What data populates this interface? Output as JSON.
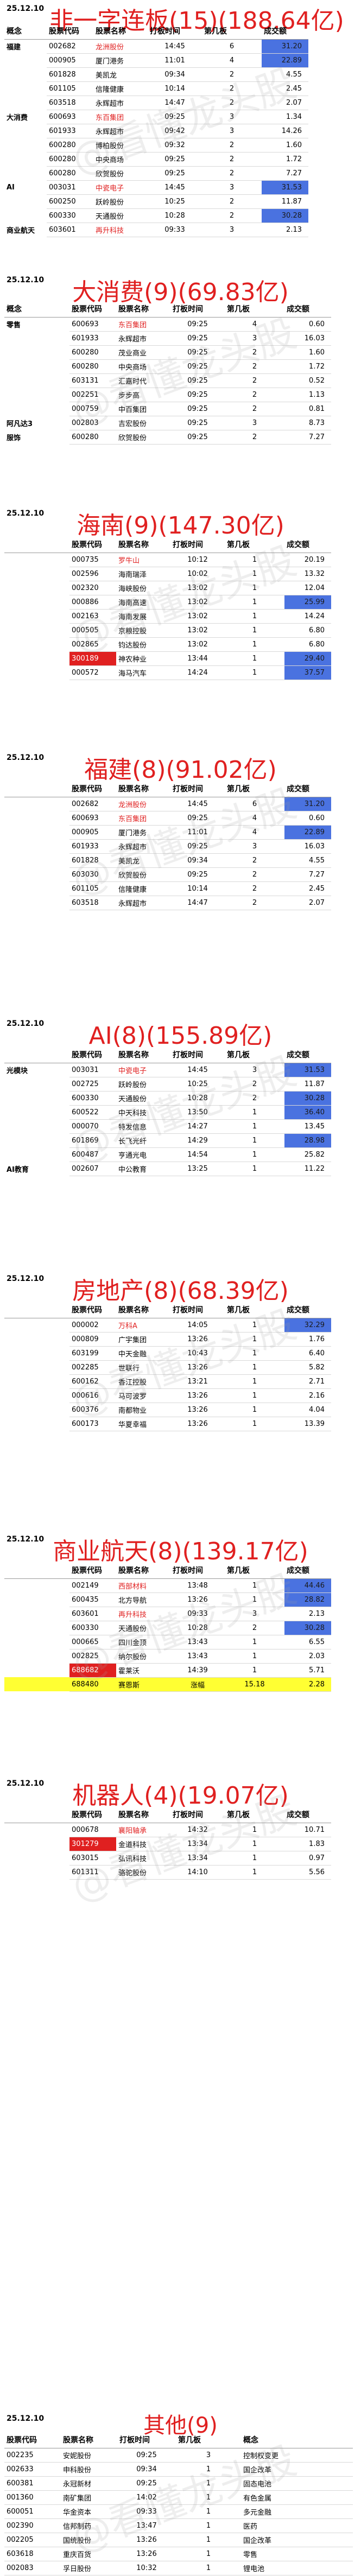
{
  "watermark": "@看懂龙头股",
  "colors": {
    "title_red": "#e02020",
    "amount_highlight": "#4a72e0",
    "row_highlight": "#ffff33"
  },
  "sections": [
    {
      "date": "25.12.10",
      "title": "非一字连板(15)(188.64亿)",
      "headers": [
        "概念",
        "股票代码",
        "股票名称",
        "打板时间",
        "第几板",
        "成交额"
      ],
      "rows": [
        {
          "concept": "福建",
          "code": "002682",
          "name": "龙洲股份",
          "time": "14:45",
          "board": "6",
          "amount": "31.20"
        },
        {
          "concept": "",
          "code": "000905",
          "name": "厦门港务",
          "time": "11:01",
          "board": "4",
          "amount": "22.89"
        },
        {
          "concept": "",
          "code": "601828",
          "name": "美凯龙",
          "time": "09:34",
          "board": "2",
          "amount": "4.55"
        },
        {
          "concept": "",
          "code": "601105",
          "name": "信隆健康",
          "time": "10:14",
          "board": "2",
          "amount": "2.45"
        },
        {
          "concept": "",
          "code": "603518",
          "name": "永辉超市",
          "time": "14:47",
          "board": "2",
          "amount": "2.07"
        },
        {
          "concept": "大消费",
          "code": "600693",
          "name": "东百集团",
          "time": "09:25",
          "board": "3",
          "amount": "1.34"
        },
        {
          "concept": "",
          "code": "601933",
          "name": "永辉超市",
          "time": "09:42",
          "board": "3",
          "amount": "14.26"
        },
        {
          "concept": "",
          "code": "600280",
          "name": "博柏股份",
          "time": "09:32",
          "board": "2",
          "amount": "1.60"
        },
        {
          "concept": "",
          "code": "600280",
          "name": "中央商场",
          "time": "09:25",
          "board": "2",
          "amount": "1.72"
        },
        {
          "concept": "",
          "code": "600280",
          "name": "欣贺股份",
          "time": "09:25",
          "board": "2",
          "amount": "7.27"
        },
        {
          "concept": "AI",
          "code": "003031",
          "name": "中瓷电子",
          "time": "14:45",
          "board": "3",
          "amount": "31.53"
        },
        {
          "concept": "",
          "code": "600250",
          "name": "跃岭股份",
          "time": "10:25",
          "board": "2",
          "amount": "11.87"
        },
        {
          "concept": "",
          "code": "600330",
          "name": "天通股份",
          "time": "10:28",
          "board": "2",
          "amount": "30.28"
        },
        {
          "concept": "商业航天",
          "code": "603601",
          "name": "再升科技",
          "time": "09:33",
          "board": "3",
          "amount": "2.13"
        }
      ]
    },
    {
      "date": "25.12.10",
      "title": "大消费(9)(69.83亿)",
      "headers": [
        "概念",
        "股票代码",
        "股票名称",
        "打板时间",
        "第几板",
        "成交额"
      ],
      "rows": [
        {
          "concept": "零售",
          "code": "600693",
          "name": "东百集团",
          "time": "09:25",
          "board": "4",
          "amount": "0.60"
        },
        {
          "concept": "",
          "code": "601933",
          "name": "永辉超市",
          "time": "09:25",
          "board": "3",
          "amount": "16.03"
        },
        {
          "concept": "",
          "code": "600280",
          "name": "茂业商业",
          "time": "09:25",
          "board": "2",
          "amount": "1.60"
        },
        {
          "concept": "",
          "code": "600280",
          "name": "中央商场",
          "time": "09:25",
          "board": "2",
          "amount": "1.72"
        },
        {
          "concept": "",
          "code": "603131",
          "name": "汇嘉时代",
          "time": "09:25",
          "board": "2",
          "amount": "0.52"
        },
        {
          "concept": "",
          "code": "002251",
          "name": "步步高",
          "time": "09:25",
          "board": "2",
          "amount": "1.13"
        },
        {
          "concept": "",
          "code": "000759",
          "name": "中百集团",
          "time": "09:25",
          "board": "2",
          "amount": "0.81"
        },
        {
          "concept": "阿凡达3",
          "code": "002803",
          "name": "吉宏股份",
          "time": "09:25",
          "board": "3",
          "amount": "8.73"
        },
        {
          "concept": "服饰",
          "code": "600280",
          "name": "欣贺股份",
          "time": "09:25",
          "board": "2",
          "amount": "7.27"
        }
      ]
    },
    {
      "date": "25.12.10",
      "title": "海南(9)(147.30亿)",
      "headers": [
        "",
        "股票代码",
        "股票名称",
        "打板时间",
        "第几板",
        "成交额"
      ],
      "rows": [
        {
          "concept": "",
          "code": "000735",
          "name": "罗牛山",
          "time": "10:12",
          "board": "1",
          "amount": "20.19"
        },
        {
          "concept": "",
          "code": "002596",
          "name": "海南瑞泽",
          "time": "10:02",
          "board": "1",
          "amount": "13.32"
        },
        {
          "concept": "",
          "code": "002320",
          "name": "海峡股份",
          "time": "13:02",
          "board": "1",
          "amount": "12.04"
        },
        {
          "concept": "",
          "code": "000886",
          "name": "海南高速",
          "time": "13:02",
          "board": "1",
          "amount": "25.99"
        },
        {
          "concept": "",
          "code": "002163",
          "name": "海南发展",
          "time": "13:02",
          "board": "1",
          "amount": "14.24"
        },
        {
          "concept": "",
          "code": "000505",
          "name": "京粮控股",
          "time": "13:02",
          "board": "1",
          "amount": "6.80"
        },
        {
          "concept": "",
          "code": "002865",
          "name": "钧达股份",
          "time": "13:02",
          "board": "1",
          "amount": "6.80"
        },
        {
          "concept": "",
          "code": "300189",
          "name": "神农种业",
          "time": "13:44",
          "board": "1",
          "amount": "29.40"
        },
        {
          "concept": "",
          "code": "000572",
          "name": "海马汽车",
          "time": "14:24",
          "board": "1",
          "amount": "37.57"
        }
      ]
    },
    {
      "date": "25.12.10",
      "title": "福建(8)(91.02亿)",
      "headers": [
        "",
        "股票代码",
        "股票名称",
        "打板时间",
        "第几板",
        "成交额"
      ],
      "rows": [
        {
          "concept": "",
          "code": "002682",
          "name": "龙洲股份",
          "time": "14:45",
          "board": "6",
          "amount": "31.20"
        },
        {
          "concept": "",
          "code": "600693",
          "name": "东百集团",
          "time": "09:25",
          "board": "4",
          "amount": "0.60"
        },
        {
          "concept": "",
          "code": "000905",
          "name": "厦门港务",
          "time": "11:01",
          "board": "4",
          "amount": "22.89"
        },
        {
          "concept": "",
          "code": "601933",
          "name": "永辉超市",
          "time": "09:25",
          "board": "3",
          "amount": "16.03"
        },
        {
          "concept": "",
          "code": "601828",
          "name": "美凯龙",
          "time": "09:34",
          "board": "2",
          "amount": "4.55"
        },
        {
          "concept": "",
          "code": "603030",
          "name": "欣贺股份",
          "time": "09:25",
          "board": "2",
          "amount": "7.27"
        },
        {
          "concept": "",
          "code": "601105",
          "name": "信隆健康",
          "time": "10:14",
          "board": "2",
          "amount": "2.45"
        },
        {
          "concept": "",
          "code": "603518",
          "name": "永辉超市",
          "time": "14:47",
          "board": "2",
          "amount": "2.07"
        }
      ]
    },
    {
      "date": "25.12.10",
      "title": "AI(8)(155.89亿)",
      "headers": [
        "",
        "股票代码",
        "股票名称",
        "打板时间",
        "第几板",
        "成交额"
      ],
      "rows": [
        {
          "concept": "光模块",
          "code": "003031",
          "name": "中瓷电子",
          "time": "14:45",
          "board": "3",
          "amount": "31.53"
        },
        {
          "concept": "",
          "code": "002725",
          "name": "跃岭股份",
          "time": "10:25",
          "board": "2",
          "amount": "11.87"
        },
        {
          "concept": "",
          "code": "600330",
          "name": "天通股份",
          "time": "10:28",
          "board": "2",
          "amount": "30.28"
        },
        {
          "concept": "",
          "code": "600522",
          "name": "中天科技",
          "time": "13:50",
          "board": "1",
          "amount": "36.40"
        },
        {
          "concept": "",
          "code": "000070",
          "name": "特发信息",
          "time": "14:27",
          "board": "1",
          "amount": "13.45"
        },
        {
          "concept": "",
          "code": "601869",
          "name": "长飞光纤",
          "time": "14:29",
          "board": "1",
          "amount": "28.98"
        },
        {
          "concept": "",
          "code": "600487",
          "name": "亨通光电",
          "time": "14:54",
          "board": "1",
          "amount": "25.82"
        },
        {
          "concept": "AI教育",
          "code": "002607",
          "name": "中公教育",
          "time": "13:25",
          "board": "1",
          "amount": "11.22"
        }
      ]
    },
    {
      "date": "25.12.10",
      "title": "房地产(8)(68.39亿)",
      "headers": [
        "",
        "股票代码",
        "股票名称",
        "打板时间",
        "第几板",
        "成交额"
      ],
      "rows": [
        {
          "concept": "",
          "code": "000002",
          "name": "万科A",
          "time": "14:05",
          "board": "1",
          "amount": "32.29"
        },
        {
          "concept": "",
          "code": "000809",
          "name": "广宇集团",
          "time": "13:26",
          "board": "1",
          "amount": "1.76"
        },
        {
          "concept": "",
          "code": "603199",
          "name": "中天金融",
          "time": "10:43",
          "board": "1",
          "amount": "6.40"
        },
        {
          "concept": "",
          "code": "002285",
          "name": "世联行",
          "time": "13:26",
          "board": "1",
          "amount": "5.82"
        },
        {
          "concept": "",
          "code": "600162",
          "name": "香江控股",
          "time": "13:21",
          "board": "1",
          "amount": "2.71"
        },
        {
          "concept": "",
          "code": "000616",
          "name": "马可波罗",
          "time": "13:26",
          "board": "1",
          "amount": "2.16"
        },
        {
          "concept": "",
          "code": "600376",
          "name": "南都物业",
          "time": "13:26",
          "board": "1",
          "amount": "4.04"
        },
        {
          "concept": "",
          "code": "600173",
          "name": "华夏幸福",
          "time": "13:26",
          "board": "1",
          "amount": "13.39"
        }
      ]
    },
    {
      "date": "25.12.10",
      "title": "商业航天(8)(139.17亿)",
      "headers": [
        "",
        "股票代码",
        "股票名称",
        "打板时间",
        "第几板",
        "成交额"
      ],
      "rows": [
        {
          "concept": "",
          "code": "002149",
          "name": "西部材料",
          "time": "13:48",
          "board": "1",
          "amount": "44.46"
        },
        {
          "concept": "",
          "code": "600435",
          "name": "北方导航",
          "time": "13:26",
          "board": "1",
          "amount": "28.82"
        },
        {
          "concept": "",
          "code": "603601",
          "name": "再升科技",
          "time": "09:33",
          "board": "3",
          "amount": "2.13"
        },
        {
          "concept": "",
          "code": "600330",
          "name": "天通股份",
          "time": "10:28",
          "board": "2",
          "amount": "30.28"
        },
        {
          "concept": "",
          "code": "000665",
          "name": "四川金顶",
          "time": "13:43",
          "board": "1",
          "amount": "6.55"
        },
        {
          "concept": "",
          "code": "002825",
          "name": "纳尔股份",
          "time": "13:43",
          "board": "1",
          "amount": "2.03"
        },
        {
          "concept": "",
          "code": "688682",
          "name": "霍莱沃",
          "time": "14:39",
          "board": "1",
          "amount": "5.71"
        },
        {
          "concept": "",
          "code": "688480",
          "name": "赛恩斯",
          "time": "涨幅",
          "board": "15.18",
          "amount": "2.28",
          "yellow": true
        }
      ]
    },
    {
      "date": "25.12.10",
      "title": "机器人(4)(19.07亿)",
      "headers": [
        "",
        "股票代码",
        "股票名称",
        "打板时间",
        "第几板",
        "成交额"
      ],
      "rows": [
        {
          "concept": "",
          "code": "000678",
          "name": "襄阳轴承",
          "time": "14:32",
          "board": "1",
          "amount": "10.71"
        },
        {
          "concept": "",
          "code": "301279",
          "name": "金道科技",
          "time": "13:34",
          "board": "1",
          "amount": "1.83"
        },
        {
          "concept": "",
          "code": "603015",
          "name": "弘讯科技",
          "time": "13:34",
          "board": "1",
          "amount": "0.97"
        },
        {
          "concept": "",
          "code": "601311",
          "name": "骆驼股份",
          "time": "14:10",
          "board": "1",
          "amount": "5.56"
        }
      ]
    },
    {
      "date": "25.12.10",
      "title": "其他(9)",
      "headers": [
        "股票代码",
        "股票名称",
        "打板时间",
        "第几板",
        "概念"
      ],
      "rows": [
        {
          "code": "002235",
          "name": "安妮股份",
          "time": "09:25",
          "board": "3",
          "concept": "控制权变更"
        },
        {
          "code": "002633",
          "name": "申科股份",
          "time": "09:34",
          "board": "1",
          "concept": "国企改革"
        },
        {
          "code": "600381",
          "name": "永冠新材",
          "time": "09:25",
          "board": "1",
          "concept": "固态电池"
        },
        {
          "code": "001360",
          "name": "南矿集团",
          "time": "14:02",
          "board": "1",
          "concept": "有色金属"
        },
        {
          "code": "600051",
          "name": "华金资本",
          "time": "09:33",
          "board": "1",
          "concept": "多元金融"
        },
        {
          "code": "002390",
          "name": "信邦制药",
          "time": "13:47",
          "board": "1",
          "concept": "医药"
        },
        {
          "code": "002205",
          "name": "国统股份",
          "time": "13:26",
          "board": "1",
          "concept": "国企改革"
        },
        {
          "code": "603618",
          "name": "重庆百货",
          "time": "13:26",
          "board": "1",
          "concept": "零售"
        },
        {
          "code": "002083",
          "name": "孚日股份",
          "time": "10:32",
          "board": "1",
          "concept": "锂电池"
        }
      ]
    }
  ]
}
